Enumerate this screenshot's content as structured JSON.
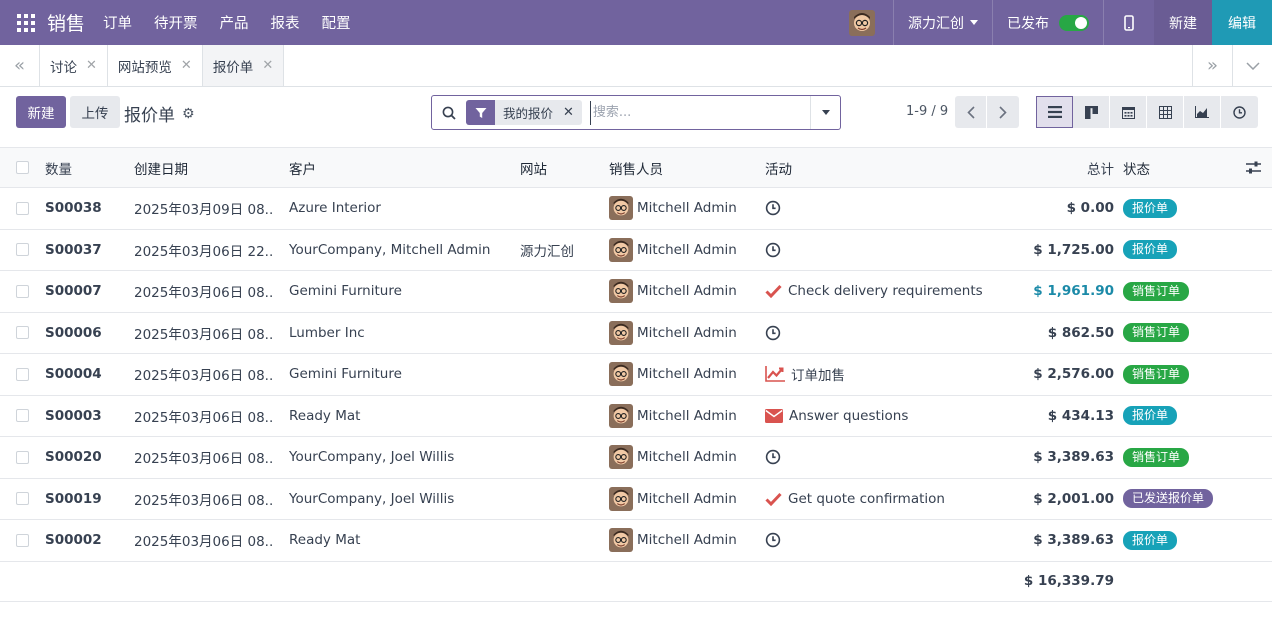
{
  "navbar": {
    "app_name": "销售",
    "menus": [
      "订单",
      "待开票",
      "产品",
      "报表",
      "配置"
    ],
    "company": "源力汇创",
    "published": "已发布",
    "new_button": "新建",
    "edit_button": "编辑"
  },
  "breadcrumbs": [
    {
      "label": "讨论"
    },
    {
      "label": "网站预览"
    },
    {
      "label": "报价单"
    }
  ],
  "control": {
    "new_button": "新建",
    "upload_button": "上传",
    "title": "报价单",
    "facet": "我的报价",
    "search_placeholder": "搜索...",
    "pager": "1-9 / 9"
  },
  "table": {
    "headers": {
      "number": "数量",
      "date": "创建日期",
      "customer": "客户",
      "website": "网站",
      "salesperson": "销售人员",
      "activity": "活动",
      "total": "总计",
      "status": "状态"
    },
    "rows": [
      {
        "number": "S00038",
        "date": "2025年03月09日 08...",
        "customer": "Azure Interior",
        "website": "",
        "salesperson": "Mitchell Admin",
        "activity_icon": "clock-icon",
        "activity": "",
        "total": "$ 0.00",
        "status": "报价单",
        "status_kind": "quote"
      },
      {
        "number": "S00037",
        "date": "2025年03月06日 22...",
        "customer": "YourCompany, Mitchell Admin",
        "website": "源力汇创",
        "salesperson": "Mitchell Admin",
        "activity_icon": "clock-icon",
        "activity": "",
        "total": "$ 1,725.00",
        "status": "报价单",
        "status_kind": "quote"
      },
      {
        "number": "S00007",
        "date": "2025年03月06日 08...",
        "customer": "Gemini Furniture",
        "website": "",
        "salesperson": "Mitchell Admin",
        "activity_icon": "check-icon",
        "activity": "Check delivery requirements",
        "total": "$ 1,961.90",
        "total_highlight": true,
        "status": "销售订单",
        "status_kind": "order"
      },
      {
        "number": "S00006",
        "date": "2025年03月06日 08...",
        "customer": "Lumber Inc",
        "website": "",
        "salesperson": "Mitchell Admin",
        "activity_icon": "clock-icon",
        "activity": "",
        "total": "$ 862.50",
        "status": "销售订单",
        "status_kind": "order"
      },
      {
        "number": "S00004",
        "date": "2025年03月06日 08...",
        "customer": "Gemini Furniture",
        "website": "",
        "salesperson": "Mitchell Admin",
        "activity_icon": "trend-chart-icon",
        "activity": "订单加售",
        "total": "$ 2,576.00",
        "status": "销售订单",
        "status_kind": "order"
      },
      {
        "number": "S00003",
        "date": "2025年03月06日 08...",
        "customer": "Ready Mat",
        "website": "",
        "salesperson": "Mitchell Admin",
        "activity_icon": "envelope-icon",
        "activity": "Answer questions",
        "total": "$ 434.13",
        "status": "报价单",
        "status_kind": "quote"
      },
      {
        "number": "S00020",
        "date": "2025年03月06日 08...",
        "customer": "YourCompany, Joel Willis",
        "website": "",
        "salesperson": "Mitchell Admin",
        "activity_icon": "clock-icon",
        "activity": "",
        "total": "$ 3,389.63",
        "status": "销售订单",
        "status_kind": "order"
      },
      {
        "number": "S00019",
        "date": "2025年03月06日 08...",
        "customer": "YourCompany, Joel Willis",
        "website": "",
        "salesperson": "Mitchell Admin",
        "activity_icon": "check-icon",
        "activity": "Get quote confirmation",
        "total": "$ 2,001.00",
        "status": "已发送报价单",
        "status_kind": "sent"
      },
      {
        "number": "S00002",
        "date": "2025年03月06日 08...",
        "customer": "Ready Mat",
        "website": "",
        "salesperson": "Mitchell Admin",
        "activity_icon": "clock-icon",
        "activity": "",
        "total": "$ 3,389.63",
        "status": "报价单",
        "status_kind": "quote"
      }
    ],
    "grand_total": "$ 16,339.79"
  },
  "colors": {
    "brand": "#71639e",
    "edit_button": "#1f9ab5",
    "quote_badge": "#17a2b8",
    "order_badge": "#28a745",
    "sent_badge": "#71639e",
    "activity_red": "#d9534f"
  }
}
